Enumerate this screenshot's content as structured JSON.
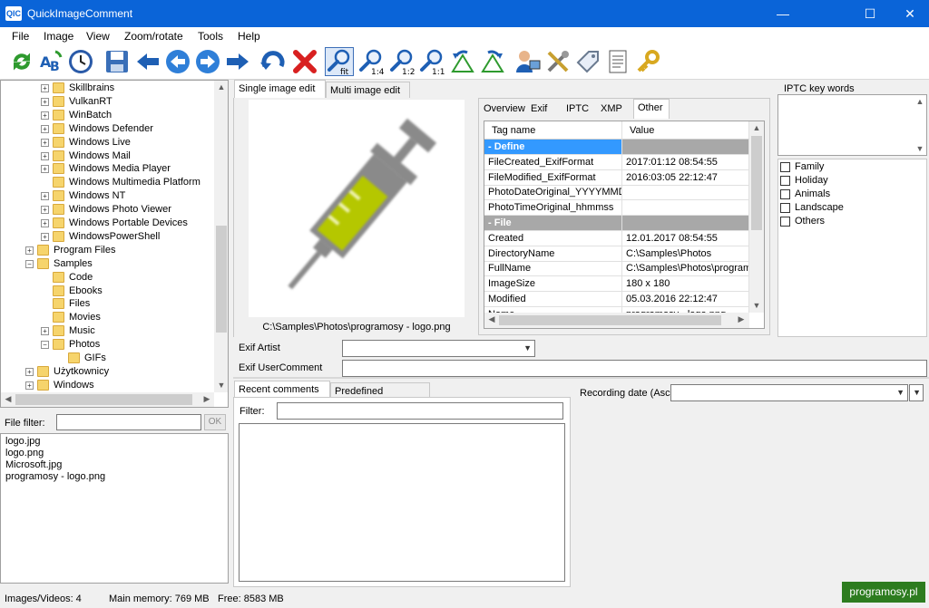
{
  "window": {
    "title": "QuickImageComment",
    "icon_text": "QIC"
  },
  "menu": [
    "File",
    "Image",
    "View",
    "Zoom/rotate",
    "Tools",
    "Help"
  ],
  "toolbar": {
    "buttons": [
      "refresh-icon",
      "rename-icon",
      "clock-icon",
      "save-icon",
      "first-icon",
      "previous-icon",
      "next-icon",
      "last-icon",
      "undo-icon",
      "delete-icon",
      "zoom-fit-icon",
      "zoom-1-4-icon",
      "zoom-1-2-icon",
      "zoom-1-1-icon",
      "rotate-left-icon",
      "rotate-right-icon",
      "user-settings-icon",
      "tools-icon",
      "tag-icon",
      "document-icon",
      "key-icon"
    ],
    "zoom_fit": "fit",
    "zoom_quarter": "1:4",
    "zoom_half": "1:2",
    "zoom_full": "1:1"
  },
  "tree": {
    "items": [
      {
        "label": "Skillbrains",
        "level": 3,
        "expander": "+"
      },
      {
        "label": "VulkanRT",
        "level": 3,
        "expander": "+"
      },
      {
        "label": "WinBatch",
        "level": 3,
        "expander": "+"
      },
      {
        "label": "Windows Defender",
        "level": 3,
        "expander": "+"
      },
      {
        "label": "Windows Live",
        "level": 3,
        "expander": "+"
      },
      {
        "label": "Windows Mail",
        "level": 3,
        "expander": "+"
      },
      {
        "label": "Windows Media Player",
        "level": 3,
        "expander": "+"
      },
      {
        "label": "Windows Multimedia Platform",
        "level": 3,
        "expander": ""
      },
      {
        "label": "Windows NT",
        "level": 3,
        "expander": "+"
      },
      {
        "label": "Windows Photo Viewer",
        "level": 3,
        "expander": "+"
      },
      {
        "label": "Windows Portable Devices",
        "level": 3,
        "expander": "+"
      },
      {
        "label": "WindowsPowerShell",
        "level": 3,
        "expander": "+"
      },
      {
        "label": "Program Files",
        "level": 2,
        "expander": "+"
      },
      {
        "label": "Samples",
        "level": 2,
        "expander": "−"
      },
      {
        "label": "Code",
        "level": 3,
        "expander": ""
      },
      {
        "label": "Ebooks",
        "level": 3,
        "expander": ""
      },
      {
        "label": "Files",
        "level": 3,
        "expander": ""
      },
      {
        "label": "Movies",
        "level": 3,
        "expander": ""
      },
      {
        "label": "Music",
        "level": 3,
        "expander": "+"
      },
      {
        "label": "Photos",
        "level": 3,
        "expander": "−"
      },
      {
        "label": "GIFs",
        "level": 4,
        "expander": ""
      },
      {
        "label": "Użytkownicy",
        "level": 2,
        "expander": "+"
      },
      {
        "label": "Windows",
        "level": 2,
        "expander": "+"
      }
    ]
  },
  "file_filter": {
    "label": "File filter:",
    "value": "",
    "ok_label": "OK"
  },
  "files": [
    "logo.jpg",
    "logo.png",
    "Microsoft.jpg",
    "programosy - logo.png"
  ],
  "edit_tabs": {
    "single": "Single image edit",
    "multi": "Multi image edit"
  },
  "image_path": "C:\\Samples\\Photos\\programosy - logo.png",
  "meta_tabs": [
    "Overview",
    "Exif",
    "IPTC",
    "XMP",
    "Other"
  ],
  "grid": {
    "headers": [
      "Tag name",
      "Value"
    ],
    "rows": [
      {
        "type": "section",
        "name": "- Define",
        "value": ""
      },
      {
        "type": "row",
        "name": "FileCreated_ExifFormat",
        "value": "2017:01:12 08:54:55"
      },
      {
        "type": "row",
        "name": "FileModified_ExifFormat",
        "value": "2016:03:05 22:12:47"
      },
      {
        "type": "row",
        "name": "PhotoDateOriginal_YYYYMMDD",
        "value": ""
      },
      {
        "type": "row",
        "name": "PhotoTimeOriginal_hhmmss",
        "value": ""
      },
      {
        "type": "section",
        "name": "- File",
        "value": ""
      },
      {
        "type": "row",
        "name": "Created",
        "value": "12.01.2017 08:54:55"
      },
      {
        "type": "row",
        "name": "DirectoryName",
        "value": "C:\\Samples\\Photos"
      },
      {
        "type": "row",
        "name": "FullName",
        "value": "C:\\Samples\\Photos\\programosy - logo.png"
      },
      {
        "type": "row",
        "name": "ImageSize",
        "value": "180 x 180"
      },
      {
        "type": "row",
        "name": "Modified",
        "value": "05.03.2016 22:12:47"
      },
      {
        "type": "row",
        "name": "Name",
        "value": "programosy - logo.png"
      }
    ]
  },
  "iptc": {
    "label": "IPTC key words",
    "keywords": [
      "Family",
      "Holiday",
      "Animals",
      "Landscape",
      "Others"
    ]
  },
  "exif_fields": {
    "artist_label": "Exif Artist",
    "artist_value": "",
    "comment_label": "Exif UserComment",
    "comment_value": ""
  },
  "comment_tabs": {
    "recent": "Recent comments",
    "predefined": "Predefined comments"
  },
  "comment_filter": {
    "label": "Filter:",
    "value": ""
  },
  "recording_date": {
    "label": "Recording date (Ascii)",
    "value": ""
  },
  "status": {
    "images": "Images/Videos: 4",
    "memory": "Main memory: 769 MB",
    "free": "Free: 8583 MB"
  },
  "watermark": "programosy.pl",
  "colors": {
    "titlebar": "#0a64d8",
    "selection": "#3399ff",
    "section": "#a8a8a8",
    "syringe_fill": "#b5c700",
    "watermark": "#2d7c1f"
  }
}
